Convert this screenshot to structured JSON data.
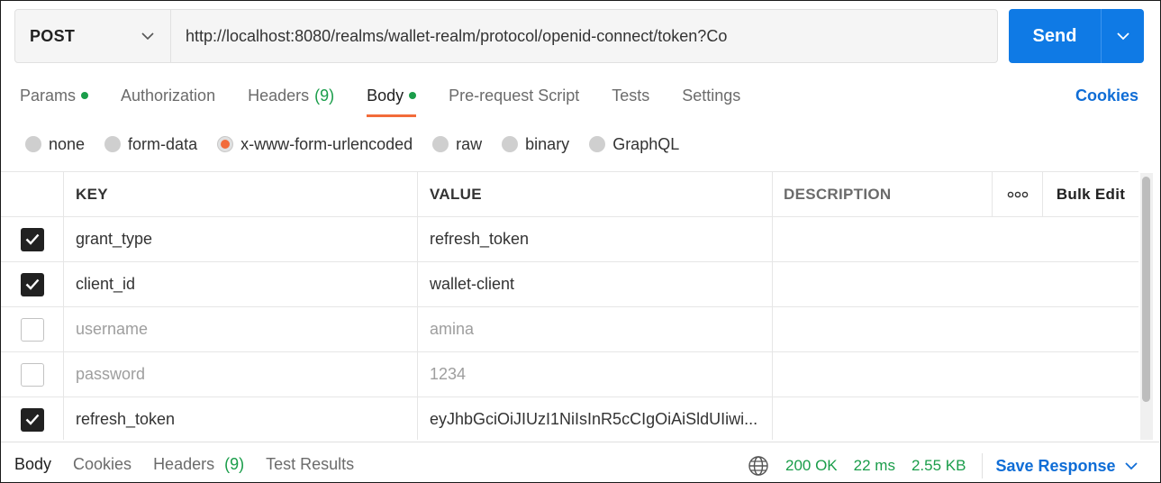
{
  "request": {
    "method": "POST",
    "url": "http://localhost:8080/realms/wallet-realm/protocol/openid-connect/token?Co",
    "send_label": "Send"
  },
  "tabs": [
    {
      "label": "Params",
      "dot": true
    },
    {
      "label": "Authorization"
    },
    {
      "label": "Headers",
      "count": "(9)"
    },
    {
      "label": "Body",
      "dot": true,
      "active": true
    },
    {
      "label": "Pre-request Script"
    },
    {
      "label": "Tests"
    },
    {
      "label": "Settings"
    }
  ],
  "cookies_label": "Cookies",
  "body_types": [
    {
      "label": "none"
    },
    {
      "label": "form-data"
    },
    {
      "label": "x-www-form-urlencoded",
      "checked": true
    },
    {
      "label": "raw"
    },
    {
      "label": "binary"
    },
    {
      "label": "GraphQL"
    }
  ],
  "table": {
    "headers": {
      "key": "KEY",
      "value": "VALUE",
      "description": "DESCRIPTION",
      "bulk_edit": "Bulk Edit"
    },
    "rows": [
      {
        "enabled": true,
        "key": "grant_type",
        "value": "refresh_token",
        "description": ""
      },
      {
        "enabled": true,
        "key": "client_id",
        "value": "wallet-client",
        "description": ""
      },
      {
        "enabled": false,
        "key": "username",
        "value": "amina",
        "description": ""
      },
      {
        "enabled": false,
        "key": "password",
        "value": "1234",
        "description": ""
      },
      {
        "enabled": true,
        "key": "refresh_token",
        "value": "eyJhbGciOiJIUzI1NiIsInR5cCIgOiAiSldUIiwi...",
        "description": ""
      }
    ]
  },
  "response": {
    "tabs": [
      {
        "label": "Body",
        "active": true
      },
      {
        "label": "Cookies"
      },
      {
        "label": "Headers",
        "count": "(9)"
      },
      {
        "label": "Test Results"
      }
    ],
    "status": "200 OK",
    "time": "22 ms",
    "size": "2.55 KB",
    "save_label": "Save Response"
  },
  "colors": {
    "accent": "#f26b3a",
    "primary": "#0f7ae5",
    "success": "#1a9d4a",
    "link": "#0f6dd6"
  }
}
